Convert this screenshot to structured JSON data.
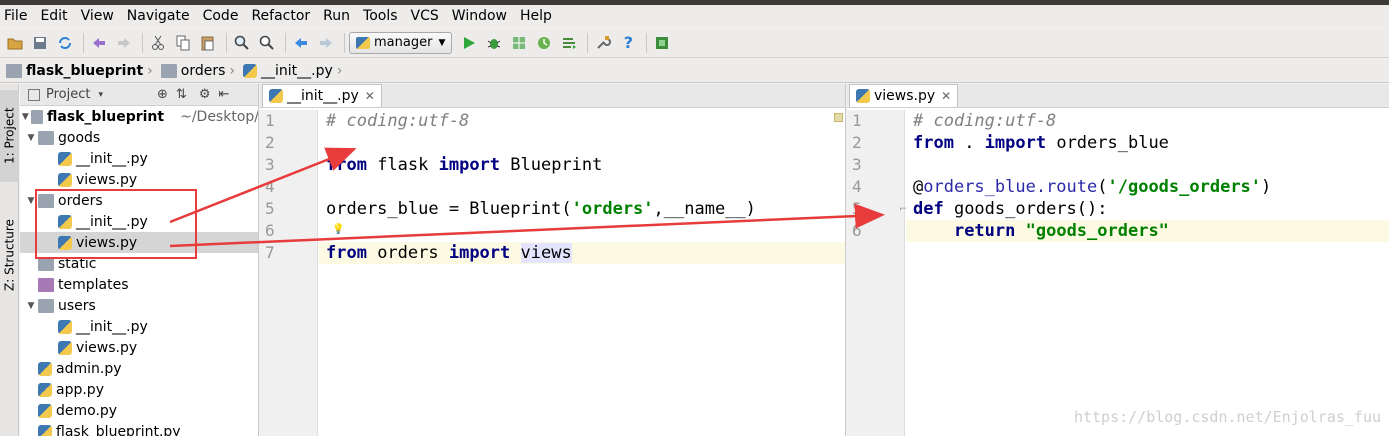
{
  "menu": {
    "items": [
      "File",
      "Edit",
      "View",
      "Navigate",
      "Code",
      "Refactor",
      "Run",
      "Tools",
      "VCS",
      "Window",
      "Help"
    ]
  },
  "toolbar": {
    "run_config": "manager",
    "icons": [
      "open-folder-icon",
      "save-icon",
      "sync-icon",
      "undo-icon",
      "redo-icon",
      "cut-icon",
      "copy-icon",
      "paste-icon",
      "find-icon",
      "replace-icon",
      "back-icon",
      "forward-icon",
      "run-icon",
      "debug-icon",
      "coverage-icon",
      "profile-icon",
      "concurrency-icon",
      "settings-icon",
      "help-icon",
      "vcs-icon"
    ]
  },
  "breadcrumbs": [
    "flask_blueprint",
    "orders",
    "__init__.py"
  ],
  "side_tabs": {
    "project": "1: Project",
    "structure": "Z: Structure"
  },
  "project_panel": {
    "header": "Project",
    "root_name": "flask_blueprint",
    "root_path": "~/Desktop/",
    "tree": [
      {
        "label": "goods",
        "type": "folder",
        "expanded": true,
        "depth": 1
      },
      {
        "label": "__init__.py",
        "type": "py",
        "depth": 2
      },
      {
        "label": "views.py",
        "type": "py",
        "depth": 2
      },
      {
        "label": "orders",
        "type": "folder",
        "expanded": true,
        "depth": 1
      },
      {
        "label": "__init__.py",
        "type": "py",
        "depth": 2
      },
      {
        "label": "views.py",
        "type": "py",
        "depth": 2,
        "selected": true
      },
      {
        "label": "static",
        "type": "folder",
        "depth": 1
      },
      {
        "label": "templates",
        "type": "template-folder",
        "depth": 1
      },
      {
        "label": "users",
        "type": "folder",
        "expanded": true,
        "depth": 1
      },
      {
        "label": "__init__.py",
        "type": "py",
        "depth": 2
      },
      {
        "label": "views.py",
        "type": "py",
        "depth": 2
      },
      {
        "label": "admin.py",
        "type": "py",
        "depth": 1
      },
      {
        "label": "app.py",
        "type": "py",
        "depth": 1
      },
      {
        "label": "demo.py",
        "type": "py",
        "depth": 1
      },
      {
        "label": "flask_blueprint.py",
        "type": "py",
        "depth": 1
      }
    ]
  },
  "editor_left": {
    "tab": "__init__.py",
    "line_numbers": [
      "1",
      "2",
      "3",
      "4",
      "5",
      "6",
      "7"
    ],
    "lines": [
      [
        {
          "t": "# coding:utf-8",
          "c": "cm"
        }
      ],
      [],
      [
        {
          "t": "from",
          "c": "kw"
        },
        {
          "t": " flask ",
          "c": ""
        },
        {
          "t": "import",
          "c": "kw"
        },
        {
          "t": " Blueprint",
          "c": ""
        }
      ],
      [],
      [
        {
          "t": "orders_blue = Blueprint(",
          "c": ""
        },
        {
          "t": "'orders'",
          "c": "str"
        },
        {
          "t": ",__name__)",
          "c": ""
        }
      ],
      [],
      [
        {
          "t": "from",
          "c": "kw"
        },
        {
          "t": " orders ",
          "c": ""
        },
        {
          "t": "import",
          "c": "kw"
        },
        {
          "t": " ",
          "c": ""
        },
        {
          "t": "views",
          "c": "hl"
        }
      ]
    ]
  },
  "editor_right": {
    "tab": "views.py",
    "line_numbers": [
      "1",
      "2",
      "3",
      "4",
      "5",
      "6"
    ],
    "lines": [
      [
        {
          "t": "# coding:utf-8",
          "c": "cm"
        }
      ],
      [
        {
          "t": "from",
          "c": "kw"
        },
        {
          "t": " . ",
          "c": ""
        },
        {
          "t": "import",
          "c": "kw"
        },
        {
          "t": " orders_blue",
          "c": ""
        }
      ],
      [],
      [
        {
          "t": "@",
          "c": ""
        },
        {
          "t": "orders_blue.route",
          "c": "dec"
        },
        {
          "t": "(",
          "c": ""
        },
        {
          "t": "'/goods_orders'",
          "c": "str"
        },
        {
          "t": ")",
          "c": ""
        }
      ],
      [
        {
          "t": "def",
          "c": "kw"
        },
        {
          "t": " goods_orders():",
          "c": ""
        }
      ],
      [
        {
          "t": "    ",
          "c": ""
        },
        {
          "t": "return",
          "c": "kw"
        },
        {
          "t": " ",
          "c": ""
        },
        {
          "t": "\"goods_orders\"",
          "c": "str"
        }
      ]
    ]
  },
  "watermark": "https://blog.csdn.net/Enjolras_fuu",
  "colors": {
    "annotation_red": "#e83b3b",
    "keyword": "#000080",
    "string": "#008000",
    "comment": "#808080"
  }
}
